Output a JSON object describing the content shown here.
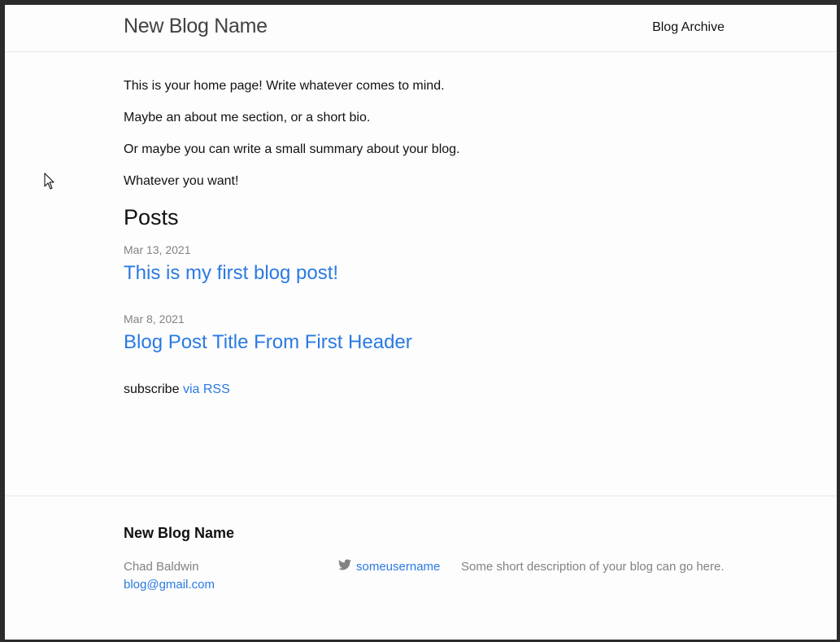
{
  "header": {
    "site_title": "New Blog Name",
    "nav": [
      {
        "label": "Blog Archive"
      }
    ]
  },
  "main": {
    "intro_paragraphs": [
      "This is your home page! Write whatever comes to mind.",
      "Maybe an about me section, or a short bio.",
      "Or maybe you can write a small summary about your blog.",
      "Whatever you want!"
    ],
    "posts_heading": "Posts",
    "posts": [
      {
        "date": "Mar 13, 2021",
        "title": "This is my first blog post!"
      },
      {
        "date": "Mar 8, 2021",
        "title": "Blog Post Title From First Header"
      }
    ],
    "subscribe_text": "subscribe",
    "subscribe_link": "via RSS"
  },
  "footer": {
    "heading": "New Blog Name",
    "author_name": "Chad Baldwin",
    "email": "blog@gmail.com",
    "twitter_username": "someusername",
    "description": "Some short description of your blog can go here."
  },
  "colors": {
    "link": "#2a7ae2",
    "meta": "#828282",
    "text": "#111111",
    "background": "#fdfdfd",
    "border": "#e8e8e8"
  },
  "icons": {
    "twitter": "twitter-icon",
    "cursor": "mouse-pointer-icon"
  }
}
